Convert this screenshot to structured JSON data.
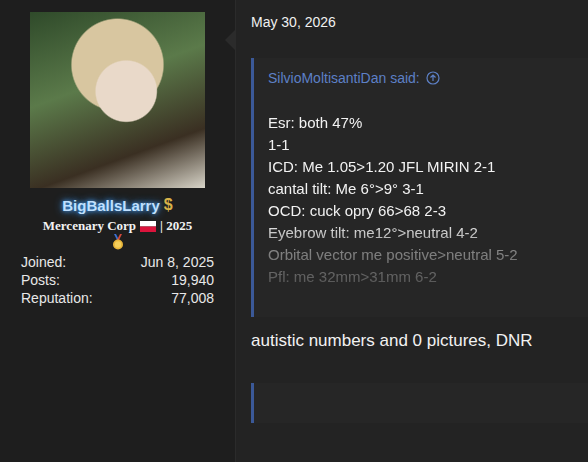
{
  "user": {
    "name": "BigBallsLarry",
    "name_icon": "$",
    "title": "Mercenary Corp",
    "title_suffix": "| 2025",
    "stats": [
      {
        "label": "Joined:",
        "value": "Jun 8, 2025"
      },
      {
        "label": "Posts:",
        "value": "19,940"
      },
      {
        "label": "Reputation:",
        "value": "77,008"
      }
    ]
  },
  "post": {
    "date": "May 30, 2026",
    "quote": {
      "author": "SilvioMoltisantiDan said:",
      "lines": [
        "Esr: both 47%",
        "1-1",
        "ICD: Me 1.05>1.20 JFL MIRIN 2-1",
        "cantal tilt: Me 6°>9° 3-1",
        "OCD: cuck opry 66>68 2-3",
        "Eyebrow tilt: me12°>neutral 4-2",
        "Orbital vector me positive>neutral 5-2",
        "Pfl: me 32mm>31mm 6-2"
      ]
    },
    "body": "autistic numbers and 0 pictures, DNR"
  }
}
